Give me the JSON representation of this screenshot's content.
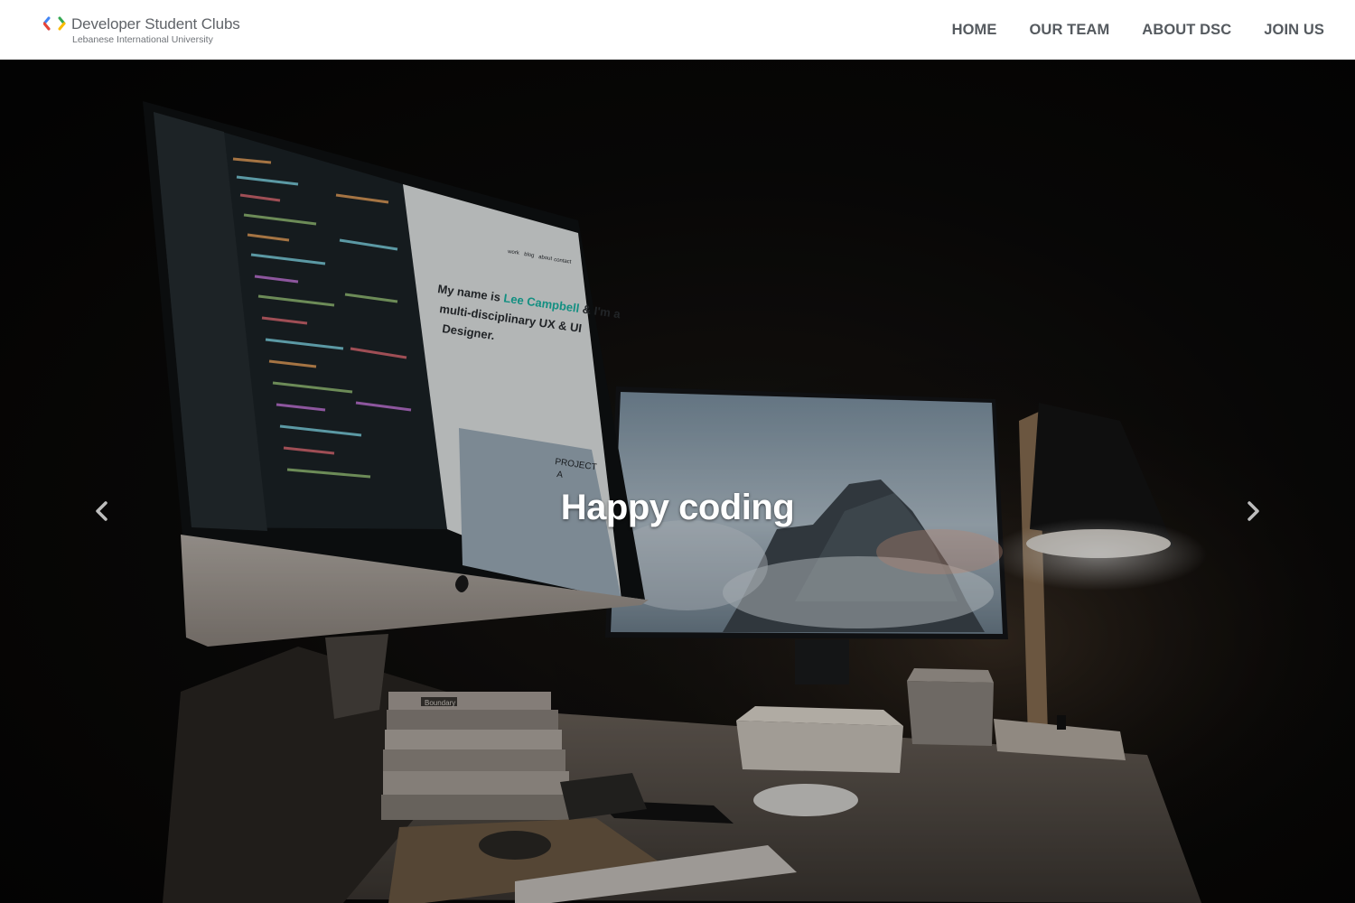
{
  "brand": {
    "title": "Developer Student Clubs",
    "subtitle": "Lebanese International University",
    "logo_colors": [
      "#4285F4",
      "#EA4335",
      "#34A853",
      "#FBBC04"
    ]
  },
  "nav": {
    "items": [
      {
        "label": "HOME"
      },
      {
        "label": "OUR TEAM"
      },
      {
        "label": "ABOUT DSC"
      },
      {
        "label": "JOIN US"
      }
    ]
  },
  "hero": {
    "caption": "Happy coding",
    "prev_icon": "chevron-left-icon",
    "next_icon": "chevron-right-icon"
  },
  "screen_text": {
    "site_heading_prefix": "My name is",
    "site_heading_name": "Lee Campbell",
    "site_heading_rest_1": "& I'm a",
    "site_heading_rest_2": "multi-disciplinary UX & UI",
    "site_heading_rest_3": "Designer.",
    "site_nav": [
      "work",
      "blog",
      "about",
      "contact"
    ],
    "project_label_1": "PROJECT",
    "project_label_2": "A",
    "book_label": "Boundary"
  }
}
